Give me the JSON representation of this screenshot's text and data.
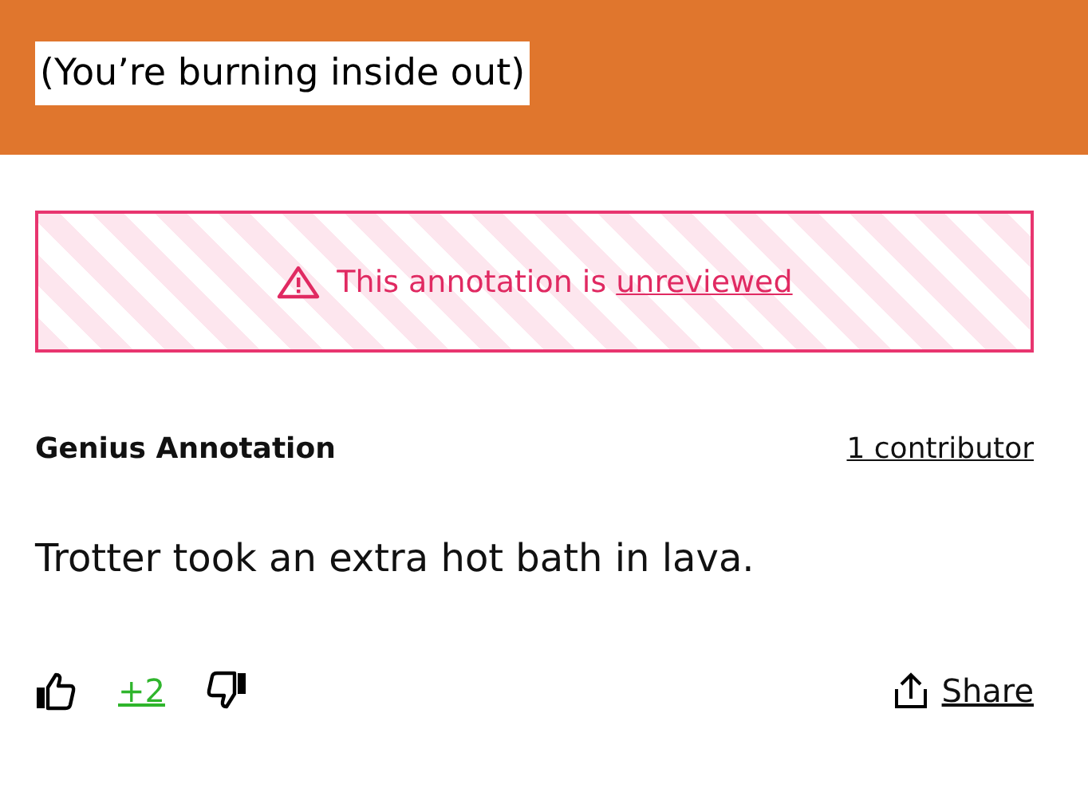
{
  "header": {
    "lyric": "(You’re burning inside out)"
  },
  "notice": {
    "text": "This annotation is",
    "link": "unreviewed"
  },
  "meta": {
    "label": "Genius Annotation",
    "contributors": "1 contributor"
  },
  "body": {
    "text": "Trotter took an extra hot bath in lava."
  },
  "actions": {
    "score": "+2",
    "share": "Share"
  }
}
